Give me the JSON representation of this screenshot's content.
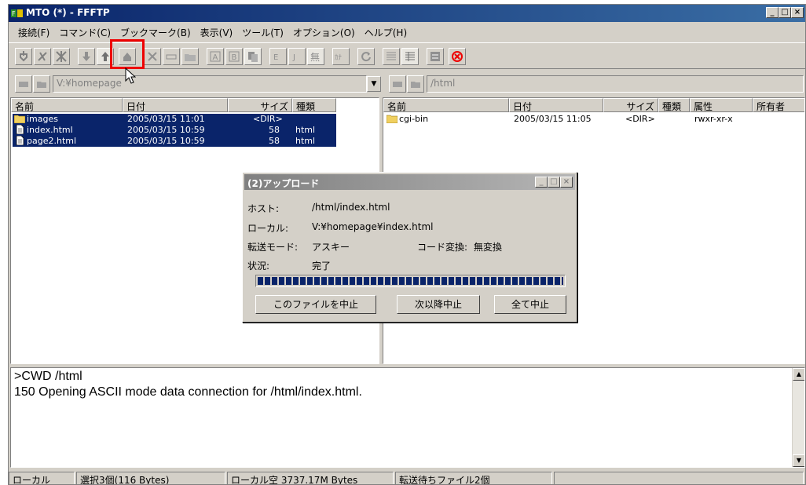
{
  "window": {
    "title": "MTO (*) - FFFTP",
    "controls": [
      "_",
      "□",
      "×"
    ]
  },
  "menu": [
    "接続(F)",
    "コマンド(C)",
    "ブックマーク(B)",
    "表示(V)",
    "ツール(T)",
    "オプション(O)",
    "ヘルプ(H)"
  ],
  "toolbar": {
    "icons": [
      "connect-icon",
      "disconnect-icon",
      "quick-connect-icon",
      "download-icon",
      "upload-icon",
      "mirror-upload-icon",
      "delete-icon",
      "rename-icon",
      "mkdir-icon",
      "ascii-mode-icon",
      "binary-mode-icon",
      "auto-mode-icon",
      "euc-icon",
      "jis-icon",
      "no-convert-icon",
      "kana-icon",
      "refresh-icon",
      "list-view-icon",
      "detail-view-icon",
      "sync-icon",
      "stop-icon"
    ],
    "labels": {
      "a": "A",
      "b": "B",
      "e": "E",
      "j": "J",
      "nc": "無",
      "kana": "ｶﾅ"
    }
  },
  "local": {
    "path": "V:¥homepage",
    "columns": [
      "名前",
      "日付",
      "サイズ",
      "種類"
    ],
    "rows": [
      {
        "name": "images",
        "date": "2005/03/15 11:01",
        "size": "<DIR>",
        "type": "",
        "icon": "folder-icon"
      },
      {
        "name": "index.html",
        "date": "2005/03/15 10:59",
        "size": "58",
        "type": "html",
        "icon": "file-icon"
      },
      {
        "name": "page2.html",
        "date": "2005/03/15 10:59",
        "size": "58",
        "type": "html",
        "icon": "file-icon"
      }
    ]
  },
  "remote": {
    "path": "/html",
    "columns": [
      "名前",
      "日付",
      "サイズ",
      "種類",
      "属性",
      "所有者"
    ],
    "rows": [
      {
        "name": "cgi-bin",
        "date": "2005/03/15 11:05",
        "size": "<DIR>",
        "type": "",
        "attr": "rwxr-xr-x",
        "icon": "folder-icon"
      }
    ]
  },
  "log": [
    ">CWD /html",
    "150 Opening ASCII mode data connection for /html/index.html."
  ],
  "status": [
    "ローカル",
    "選択3個(116 Bytes)",
    "ローカル空 3737.17M Bytes",
    "転送待ちファイル2個",
    ""
  ],
  "dialog": {
    "title": "(2)アップロード",
    "host_label": "ホスト:",
    "host": "/html/index.html",
    "local_label": "ローカル:",
    "local": "V:¥homepage¥index.html",
    "mode_label": "転送モード:",
    "mode": "アスキー",
    "conv_label": "コード変換:",
    "conv": "無変換",
    "state_label": "状況:",
    "state": "完了",
    "progress": 1.0,
    "buttons": [
      "このファイルを中止",
      "次以降中止",
      "全て中止"
    ]
  }
}
